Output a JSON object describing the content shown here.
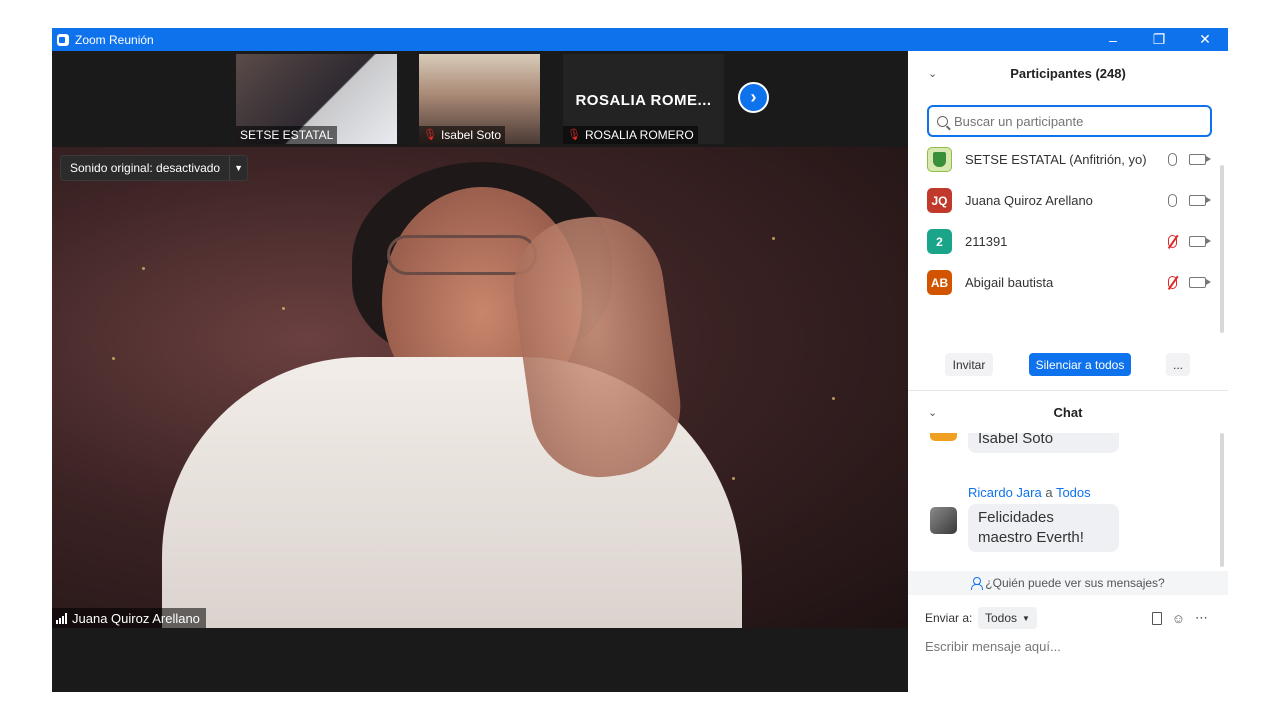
{
  "window": {
    "title": "Zoom Reunión"
  },
  "thumbnails": [
    {
      "name": "SETSE ESTATAL"
    },
    {
      "name": "Isabel Soto"
    },
    {
      "name": "ROSALIA ROMERO",
      "display_name": "ROSALIA  ROME..."
    }
  ],
  "main_video": {
    "sound_button": "Sonido original: desactivado",
    "speaker_name": "Juana Quiroz Arellano"
  },
  "participants": {
    "title": "Participantes (248)",
    "search_placeholder": "Buscar un participante",
    "list": [
      {
        "initials": "",
        "name": "SETSE ESTATAL (Anfitrión, yo)",
        "avatar_color": "#d9e8b0",
        "mic": "on"
      },
      {
        "initials": "JQ",
        "name": "Juana Quiroz Arellano",
        "avatar_color": "#c0392b",
        "mic": "on"
      },
      {
        "initials": "2",
        "name": "211391",
        "avatar_color": "#1aa58a",
        "mic": "muted"
      },
      {
        "initials": "AB",
        "name": "Abigail bautista",
        "avatar_color": "#d35400",
        "mic": "muted"
      }
    ],
    "buttons": {
      "invite": "Invitar",
      "mute_all": "Silenciar a todos",
      "more": "..."
    }
  },
  "chat": {
    "title": "Chat",
    "messages": [
      {
        "text": "Isabel Soto"
      },
      {
        "sender": "Ricardo Jara",
        "connector": "a",
        "recipient": "Todos",
        "text": "Felicidades maestro Everth!"
      }
    ],
    "who_can_see": "¿Quién puede ver sus mensajes?",
    "send_to_label": "Enviar a:",
    "send_to_value": "Todos",
    "input_placeholder": "Escribir mensaje aquí..."
  }
}
